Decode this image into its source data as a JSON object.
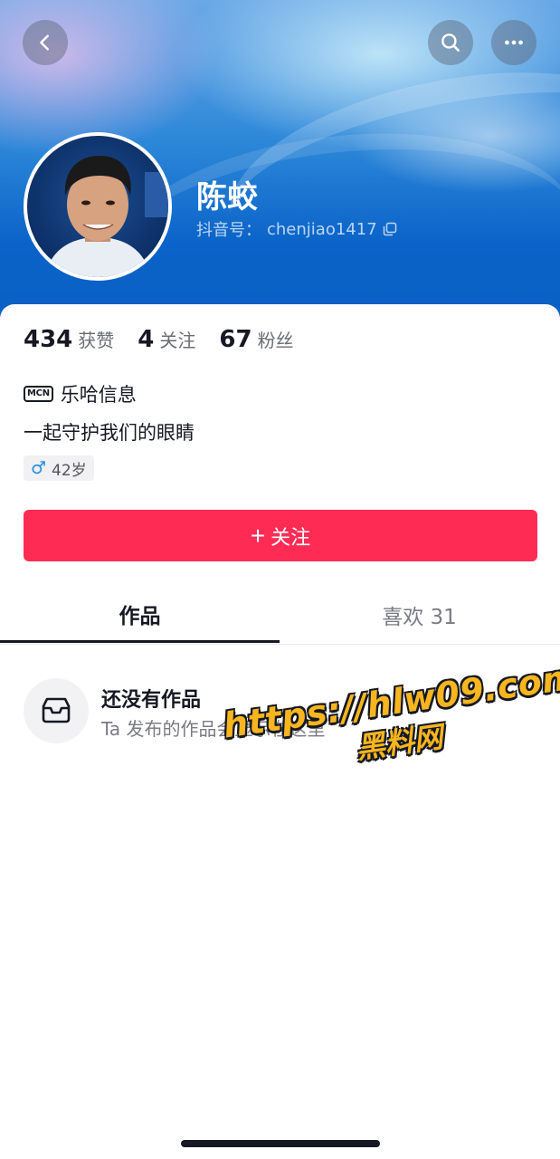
{
  "header": {
    "back_icon": "chevron-left-icon",
    "search_icon": "search-icon",
    "more_icon": "more-dots-icon"
  },
  "profile": {
    "name": "陈蛟",
    "douyin_id_label": "抖音号：",
    "douyin_id": "chenjiao1417",
    "copy_icon": "copy-icon"
  },
  "stats": [
    {
      "value": "434",
      "label": "获赞"
    },
    {
      "value": "4",
      "label": "关注"
    },
    {
      "value": "67",
      "label": "粉丝"
    }
  ],
  "mcn": {
    "badge": "MCN",
    "name": "乐哈信息"
  },
  "bio": "一起守护我们的眼睛",
  "tag": {
    "icon": "male-icon",
    "symbol": "♂",
    "text": "42岁"
  },
  "follow_button": {
    "icon": "+",
    "label": "关注"
  },
  "tabs": [
    {
      "label": "作品",
      "active": true
    },
    {
      "label": "喜欢 31",
      "active": false
    }
  ],
  "empty_state": {
    "icon": "inbox-tray-icon",
    "title": "还没有作品",
    "subtitle": "Ta 发布的作品会显示在这里"
  },
  "watermark": {
    "url": "https://hlw09.com",
    "text": "黑料网"
  },
  "colors": {
    "accent": "#fe2c55",
    "banner_blue": "#0a63c8",
    "watermark_yellow": "#f7b51e"
  }
}
